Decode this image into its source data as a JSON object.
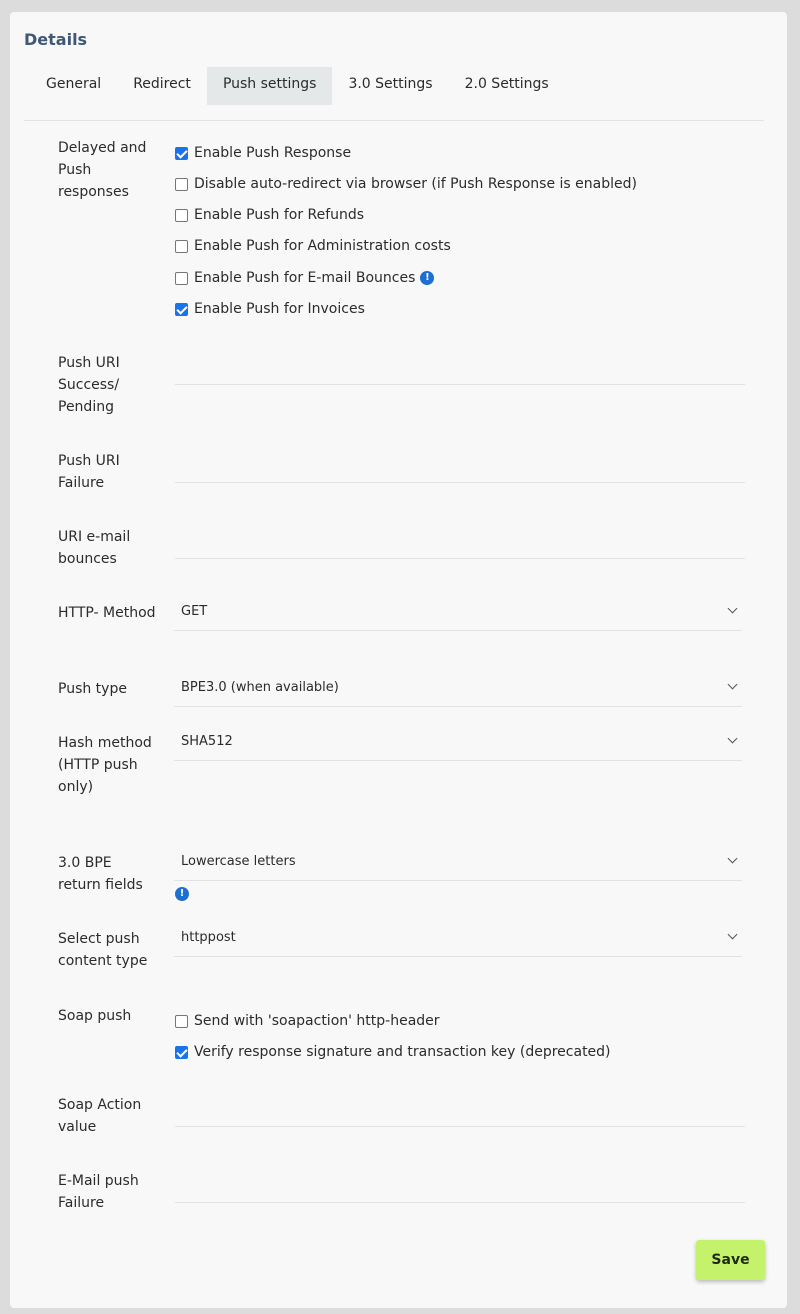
{
  "panel": {
    "title": "Details"
  },
  "tabs": [
    {
      "label": "General"
    },
    {
      "label": "Redirect"
    },
    {
      "label": "Push settings"
    },
    {
      "label": "3.0 Settings"
    },
    {
      "label": "2.0 Settings"
    }
  ],
  "active_tab": "Push settings",
  "delayed": {
    "label": "Delayed and Push responses",
    "options": [
      {
        "label": "Enable Push Response",
        "checked": true
      },
      {
        "label": "Disable auto-redirect via browser (if Push Response is enabled)",
        "checked": false
      },
      {
        "label": "Enable Push for Refunds",
        "checked": false
      },
      {
        "label": "Enable Push for Administration costs",
        "checked": false
      },
      {
        "label": "Enable Push for E-mail Bounces",
        "checked": false,
        "info_icon": "info-icon"
      },
      {
        "label": "Enable Push for Invoices",
        "checked": true
      }
    ]
  },
  "push_uri_success": {
    "label": "Push URI Success/ Pending",
    "value": ""
  },
  "push_uri_failure": {
    "label": "Push URI Failure",
    "value": ""
  },
  "uri_email_bounces": {
    "label": "URI e-mail bounces",
    "value": ""
  },
  "http_method": {
    "label": "HTTP- Method",
    "value": "GET"
  },
  "push_type": {
    "label": "Push type",
    "value": "BPE3.0 (when available)"
  },
  "hash_method": {
    "label": "Hash method (HTTP push only)",
    "value": "SHA512"
  },
  "return_fields": {
    "label": "3.0 BPE return fields",
    "value": "Lowercase letters"
  },
  "content_type": {
    "label": "Select push content type",
    "value": "httppost"
  },
  "soap_push": {
    "label": "Soap push",
    "options": [
      {
        "label": "Send with 'soapaction' http-header",
        "checked": false
      },
      {
        "label": "Verify response signature and transaction key (deprecated)",
        "checked": true
      }
    ]
  },
  "soap_action": {
    "label": "Soap Action value",
    "value": ""
  },
  "email_push_failure": {
    "label": "E-Mail push Failure",
    "value": ""
  },
  "save_label": "Save",
  "colors": {
    "accent": "#1a73e8",
    "save_button": "#c5f26b",
    "title": "#3f5873"
  }
}
